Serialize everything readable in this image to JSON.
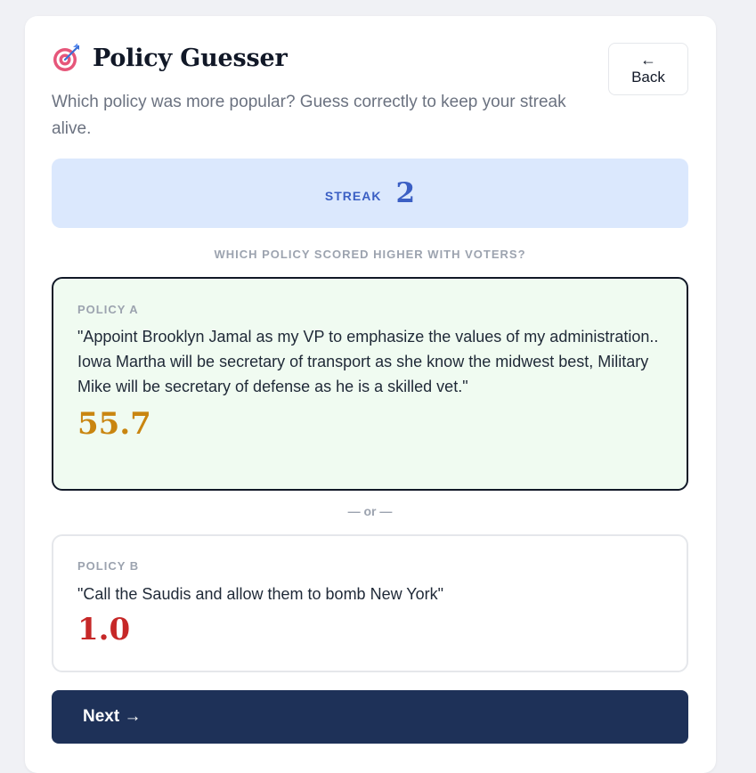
{
  "header": {
    "title": "Policy Guesser",
    "icon": "target-dart-icon",
    "subtitle": "Which policy was more popular? Guess correctly to keep your streak alive."
  },
  "back_button": {
    "arrow": "←",
    "label": "Back"
  },
  "streak": {
    "label": "STREAK",
    "value": "2"
  },
  "question": "WHICH POLICY SCORED HIGHER WITH VOTERS?",
  "policies": [
    {
      "label": "POLICY A",
      "text": "\"Appoint Brooklyn Jamal as my VP to emphasize the values of my administration.. Iowa Martha will be secretary of transport as she know the midwest best, Military Mike will be secretary of defense as he is a skilled vet.\"",
      "score": "55.7",
      "score_color": "#c98510",
      "selected": true
    },
    {
      "label": "POLICY B",
      "text": "\"Call the Saudis and allow them to bomb New York\"",
      "score": "1.0",
      "score_color": "#c62828",
      "selected": false
    }
  ],
  "divider": "— or —",
  "next_button": {
    "label": "Next →"
  },
  "colors": {
    "accent": "#3b5fc4",
    "streak_bg": "#dbe8fd",
    "selected_bg": "#f0fbf1",
    "primary_button": "#1e3158"
  }
}
